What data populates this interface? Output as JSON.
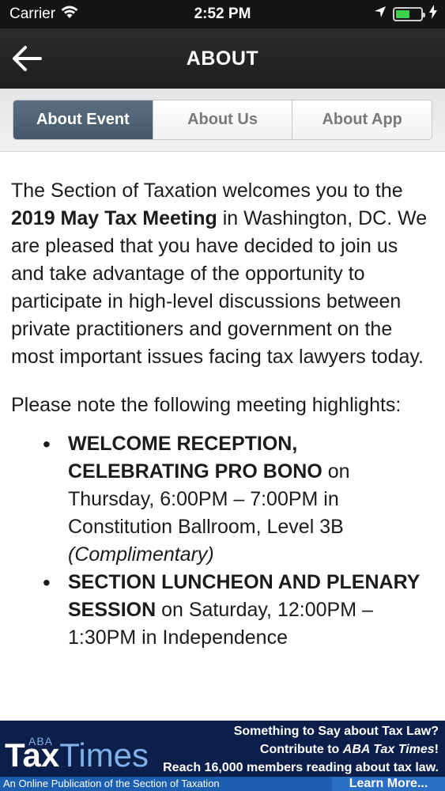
{
  "status": {
    "carrier": "Carrier",
    "time": "2:52 PM",
    "battery_level": 0.55
  },
  "nav": {
    "title": "ABOUT"
  },
  "tabs": [
    {
      "label": "About Event",
      "active": true
    },
    {
      "label": "About Us",
      "active": false
    },
    {
      "label": "About App",
      "active": false
    }
  ],
  "content": {
    "p1_a": "The Section of Taxation welcomes you to the ",
    "p1_bold": "2019 May Tax Meeting",
    "p1_b": " in Washington, DC. We are pleased that you have decided to join us and take advantage of the opportunity to participate in high-level discussions between private practitioners and government on the most important issues facing tax lawyers today.",
    "p2": "Please note the following meeting highlights:",
    "b1_bold": "WELCOME RECEPTION, CELEBRATING PRO BONO",
    "b1_text": " on Thursday, 6:00PM – 7:00PM in Constitution Ballroom, Level 3B ",
    "b1_italic": "(Complimentary)",
    "b2_bold": "SECTION LUNCHEON AND PLENARY SESSION",
    "b2_text": " on Saturday, 12:00PM – 1:30PM in Independence"
  },
  "banner": {
    "logo_aba": "ABA",
    "logo_tax": "Tax",
    "logo_times": "Times",
    "line1": "Something to Say about Tax Law?",
    "line2_a": "Contribute to ",
    "line2_italic": "ABA Tax Times",
    "line2_b": "!",
    "line3": "Reach 16,000 members reading about tax law.",
    "subtitle": "An Online Publication of the Section of Taxation",
    "learn_more": "Learn More..."
  },
  "colors": {
    "active_tab": "#4f6274",
    "banner_bg": "#0c1f4a",
    "battery": "#3bd14b"
  }
}
